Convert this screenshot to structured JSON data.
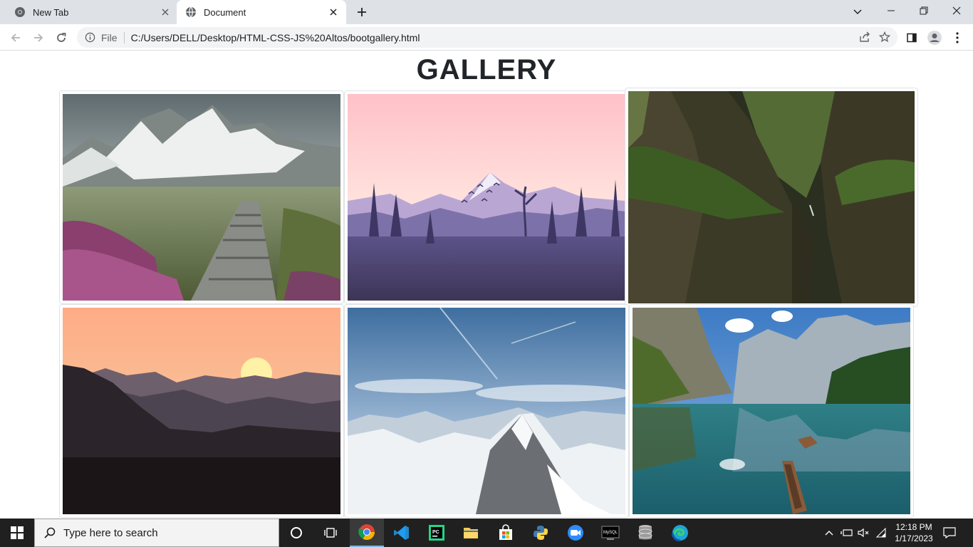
{
  "browser": {
    "tabs": [
      {
        "title": "New Tab",
        "icon": "chrome-icon",
        "active": false
      },
      {
        "title": "Document",
        "icon": "globe-icon",
        "active": true
      }
    ],
    "omnibox": {
      "scheme_label": "File",
      "url": "C:/Users/DELL/Desktop/HTML-CSS-JS%20Altos/bootgallery.html"
    }
  },
  "page": {
    "title": "GALLERY",
    "images": [
      {
        "subject": "snowy mountains with stone path and pink heather"
      },
      {
        "subject": "pink sky mountain silhouette with forest and birds"
      },
      {
        "subject": "green mossy canyon cliffs"
      },
      {
        "subject": "orange sunset over layered dark mountains"
      },
      {
        "subject": "snowy mountain peaks under blue sky"
      },
      {
        "subject": "alpine lake with rowboats and reflection"
      }
    ]
  },
  "taskbar": {
    "search_placeholder": "Type here to search",
    "apps": [
      "cortana-icon",
      "task-view-icon",
      "chrome-icon",
      "vscode-icon",
      "pycharm-icon",
      "file-explorer-icon",
      "store-icon",
      "python-icon",
      "zoom-icon",
      "mysql-icon",
      "database-icon",
      "edge-icon"
    ],
    "time": "12:18 PM",
    "date": "1/17/2023"
  },
  "colors": {
    "tabstrip": "#dee1e6",
    "taskbar": "#202020",
    "accent": "#76b9ed"
  }
}
